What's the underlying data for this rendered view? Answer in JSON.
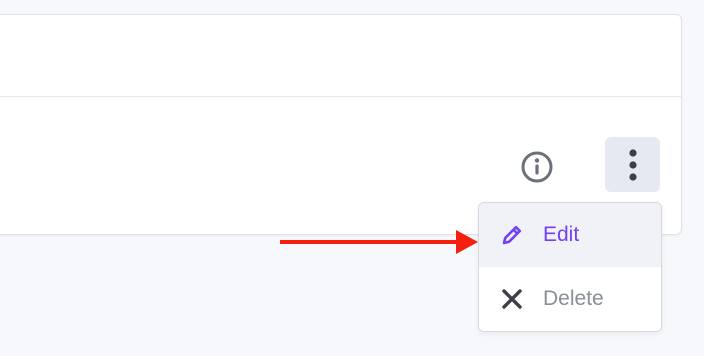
{
  "menu": {
    "edit_label": "Edit",
    "delete_label": "Delete"
  },
  "icons": {
    "info": "info-circle-icon",
    "more": "vertical-ellipsis-icon",
    "edit": "pencil-icon",
    "delete": "close-x-icon"
  },
  "colors": {
    "accent": "#7042f2",
    "muted_text": "#8a8f99",
    "icon_gray": "#6b7079",
    "icon_dark": "#3c3f45",
    "arrow_red": "#f41f0c",
    "more_button_bg": "#e6e9f1",
    "selected_item_bg": "#f1f2f7"
  }
}
